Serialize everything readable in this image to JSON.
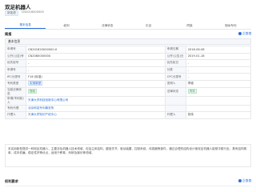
{
  "header": {
    "title": "双足机器人",
    "badge1": "新能源",
    "code": "CN2018000000"
  },
  "tabs": [
    {
      "label": "基本信息"
    },
    {
      "label": "权利"
    },
    {
      "label": "法律状态"
    },
    {
      "label": "引证"
    },
    {
      "label": "同族"
    },
    {
      "label": "相似专利"
    }
  ],
  "section": {
    "title": "简报",
    "brand": "企查查"
  },
  "box_head": "基本信息",
  "rows": [
    {
      "k1": "申请号",
      "v1": "CN201820000000.X",
      "k2": "申请日期",
      "v2": "2018-06-08"
    },
    {
      "k1": "公开(公告)号",
      "v1": "CN208000000U",
      "k2": "公开(公告)日",
      "v2": "2019-01-18"
    },
    {
      "k1": "优先权号",
      "v1": "-",
      "k2": "优先权日",
      "v2": "-"
    },
    {
      "k1": "申请号",
      "v1": "-",
      "k2": "分类",
      "v2": "-"
    },
    {
      "k1": "IPC分类号",
      "v1": "F16 (标准)",
      "k2": "CPC分类号",
      "v2": "-"
    },
    {
      "k1": "专利类型",
      "v1": "实用新型",
      "k2": "发明人",
      "v2": "李强"
    },
    {
      "k1": "当前法律状态",
      "v1": "授权",
      "k2": "法律状态",
      "v2": "有效"
    },
    {
      "k1": "申请(专利权)人",
      "v1": "天津大学科技创新中心有限公司",
      "k2": "",
      "v2": ""
    },
    {
      "k1": "专利代理",
      "v1": "北京科技专利事务所",
      "k2": "",
      "v2": ""
    },
    {
      "k1": "代理人",
      "v1": "天津大学知识产权中心",
      "k2": "代理人",
      "v2": "张伟"
    }
  ],
  "desc": "本实用新型提供一种双足机器人，主要涉及机器人技术领域，包括主体结构、腿部关节、驱动装置、控制系统、传感器等部件，通过合理的结构设计使双足机器人能够平稳行走，具有结构简单、成本低廉、稳定性好等优点，适用于教育、科研及娱乐等领域。",
  "section2": {
    "title": "权利要求",
    "brand": "企查查"
  }
}
